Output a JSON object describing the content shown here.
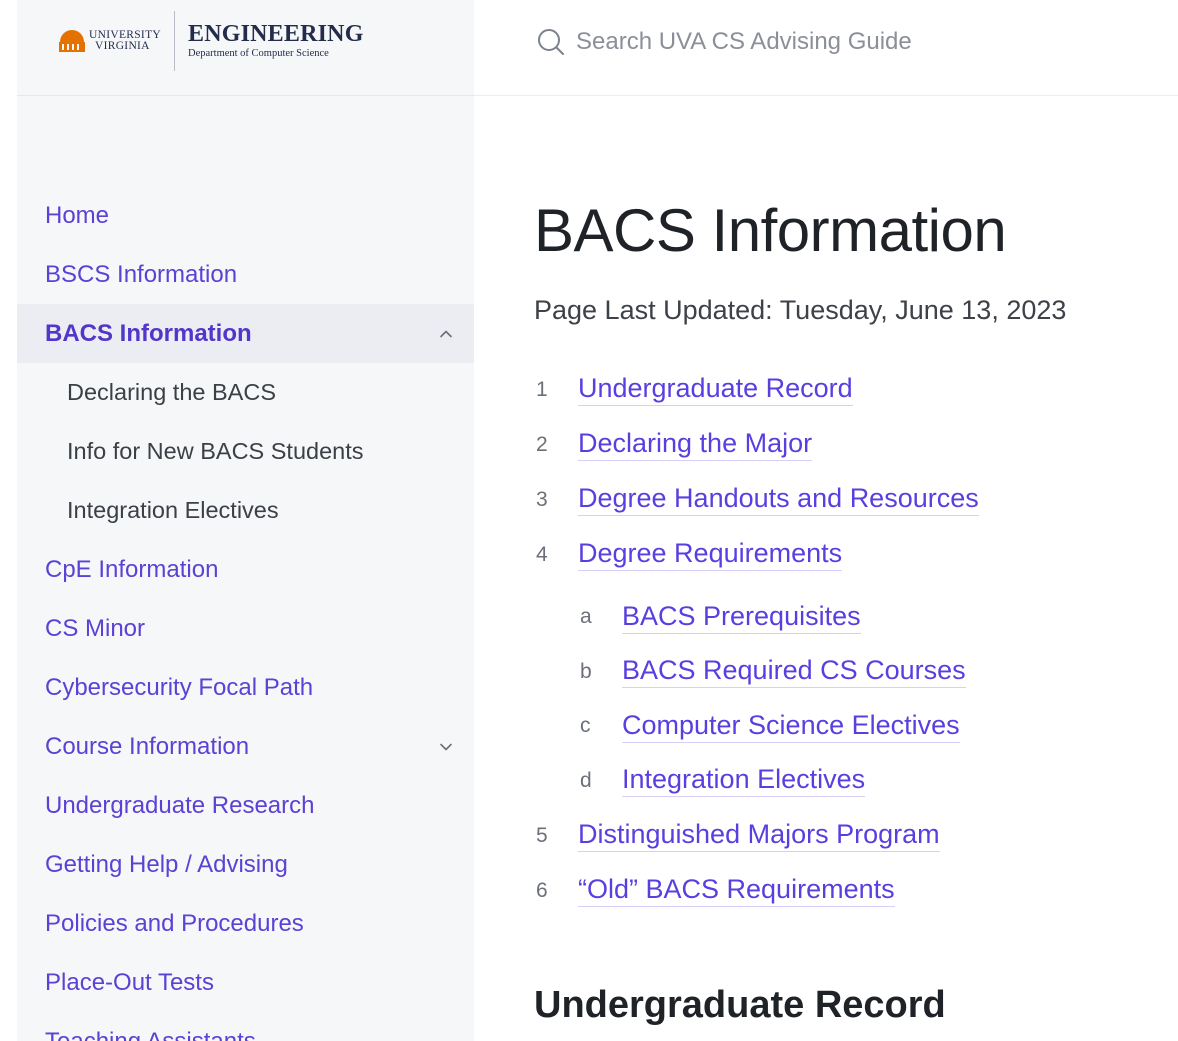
{
  "logo": {
    "university_line1": "UNIVERSITY",
    "university_line2": "VIRGINIA",
    "engineering": "ENGINEERING",
    "department": "Department of Computer Science"
  },
  "search": {
    "placeholder": "Search UVA CS Advising Guide"
  },
  "sidebar": {
    "items": [
      {
        "label": "Home"
      },
      {
        "label": "BSCS Information"
      },
      {
        "label": "BACS Information",
        "expanded": true
      },
      {
        "label": "Declaring the BACS"
      },
      {
        "label": "Info for New BACS Students"
      },
      {
        "label": "Integration Electives"
      },
      {
        "label": "CpE Information"
      },
      {
        "label": "CS Minor"
      },
      {
        "label": "Cybersecurity Focal Path"
      },
      {
        "label": "Course Information",
        "expanded": false
      },
      {
        "label": "Undergraduate Research"
      },
      {
        "label": "Getting Help / Advising"
      },
      {
        "label": "Policies and Procedures"
      },
      {
        "label": "Place-Out Tests"
      },
      {
        "label": "Teaching Assistants"
      }
    ]
  },
  "main": {
    "title": "BACS Information",
    "updated": "Page Last Updated: Tuesday, June 13, 2023",
    "toc": [
      {
        "num": "1",
        "label": "Undergraduate Record"
      },
      {
        "num": "2",
        "label": "Declaring the Major"
      },
      {
        "num": "3",
        "label": "Degree Handouts and Resources"
      },
      {
        "num": "4",
        "label": "Degree Requirements"
      },
      {
        "num": "a",
        "label": "BACS Prerequisites"
      },
      {
        "num": "b",
        "label": "BACS Required CS Courses"
      },
      {
        "num": "c",
        "label": "Computer Science Electives"
      },
      {
        "num": "d",
        "label": "Integration Electives"
      },
      {
        "num": "5",
        "label": "Distinguished Majors Program"
      },
      {
        "num": "6",
        "label": "“Old” BACS Requirements"
      }
    ],
    "section_heading": "Undergraduate Record"
  },
  "colors": {
    "link": "#5a3fe0",
    "uva_orange": "#e57200",
    "uva_navy": "#232d4b",
    "sidebar_bg": "#f6f7f9"
  }
}
